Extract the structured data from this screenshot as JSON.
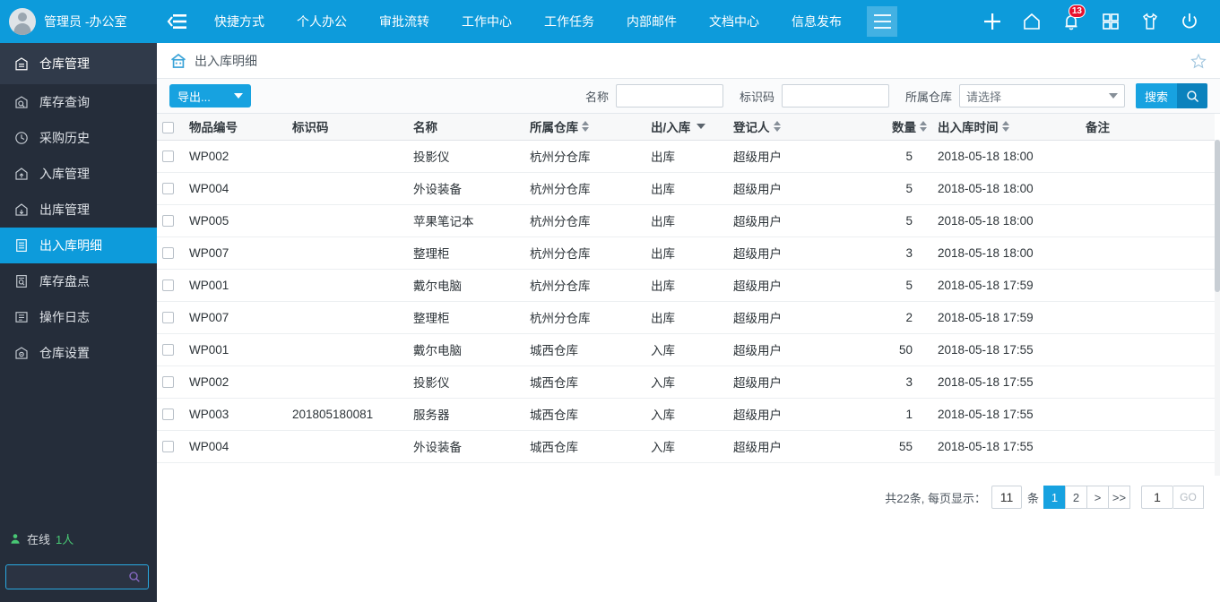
{
  "topbar": {
    "user_name": "管理员 -办公室",
    "avatar_icon": "user-avatar-icon",
    "menu_toggle_icon": "menu-collapse-icon",
    "nav_links": [
      "快捷方式",
      "个人办公",
      "审批流转",
      "工作中心",
      "工作任务",
      "内部邮件",
      "文档中心",
      "信息发布"
    ],
    "hamburger_icon": "hamburger-icon",
    "icons": [
      {
        "name": "plus-icon"
      },
      {
        "name": "home-icon"
      },
      {
        "name": "bell-icon",
        "badge": "13"
      },
      {
        "name": "grid-apps-icon"
      },
      {
        "name": "shirt-theme-icon"
      },
      {
        "name": "power-icon"
      }
    ],
    "accent_color": "#0d9bdb",
    "badge_color": "#e8112d"
  },
  "sidebar": {
    "header": {
      "label": "仓库管理",
      "icon": "warehouse-icon"
    },
    "items": [
      {
        "label": "库存查询",
        "icon": "inventory-search-icon",
        "active": false
      },
      {
        "label": "采购历史",
        "icon": "clock-history-icon",
        "active": false
      },
      {
        "label": "入库管理",
        "icon": "inbound-icon",
        "active": false
      },
      {
        "label": "出库管理",
        "icon": "outbound-icon",
        "active": false
      },
      {
        "label": "出入库明细",
        "icon": "detail-list-icon",
        "active": true
      },
      {
        "label": "库存盘点",
        "icon": "stocktake-icon",
        "active": false
      },
      {
        "label": "操作日志",
        "icon": "log-icon",
        "active": false
      },
      {
        "label": "仓库设置",
        "icon": "settings-warehouse-icon",
        "active": false
      }
    ],
    "online": {
      "icon": "person-online-icon",
      "label": "在线",
      "count": "1人",
      "count_color": "#48c774"
    },
    "search": {
      "value": "",
      "placeholder": "",
      "icon": "search-icon"
    }
  },
  "breadcrumb": {
    "icon": "home-breadcrumb-icon",
    "title": "出入库明细",
    "favorite_icon": "star-outline-icon"
  },
  "toolbar": {
    "export_label": "导出...",
    "export_caret_icon": "chevron-down-icon",
    "name_label": "名称",
    "name_value": "",
    "code_label": "标识码",
    "code_value": "",
    "warehouse_label": "所属仓库",
    "warehouse_selected": "请选择",
    "warehouse_caret_icon": "chevron-down-icon",
    "search_label": "搜索",
    "search_icon": "search-icon"
  },
  "table": {
    "select_all_checkbox": false,
    "columns": [
      {
        "key": "checkbox",
        "label": "",
        "sortable": false
      },
      {
        "key": "no",
        "label": "物品编号",
        "sortable": false
      },
      {
        "key": "code",
        "label": "标识码",
        "sortable": false
      },
      {
        "key": "name",
        "label": "名称",
        "sortable": false
      },
      {
        "key": "warehouse",
        "label": "所属仓库",
        "sortable": true
      },
      {
        "key": "io",
        "label": "出/入库",
        "sortable": false,
        "filter": true
      },
      {
        "key": "user",
        "label": "登记人",
        "sortable": true
      },
      {
        "key": "qty",
        "label": "数量",
        "sortable": true,
        "align": "right"
      },
      {
        "key": "time",
        "label": "出入库时间",
        "sortable": true
      },
      {
        "key": "note",
        "label": "备注",
        "sortable": false
      }
    ],
    "rows": [
      {
        "no": "WP002",
        "code": "",
        "name": "投影仪",
        "warehouse": "杭州分仓库",
        "io": "出库",
        "user": "超级用户",
        "qty": "5",
        "time": "2018-05-18 18:00",
        "note": ""
      },
      {
        "no": "WP004",
        "code": "",
        "name": "外设装备",
        "warehouse": "杭州分仓库",
        "io": "出库",
        "user": "超级用户",
        "qty": "5",
        "time": "2018-05-18 18:00",
        "note": ""
      },
      {
        "no": "WP005",
        "code": "",
        "name": "苹果笔记本",
        "warehouse": "杭州分仓库",
        "io": "出库",
        "user": "超级用户",
        "qty": "5",
        "time": "2018-05-18 18:00",
        "note": ""
      },
      {
        "no": "WP007",
        "code": "",
        "name": "整理柜",
        "warehouse": "杭州分仓库",
        "io": "出库",
        "user": "超级用户",
        "qty": "3",
        "time": "2018-05-18 18:00",
        "note": ""
      },
      {
        "no": "WP001",
        "code": "",
        "name": "戴尔电脑",
        "warehouse": "杭州分仓库",
        "io": "出库",
        "user": "超级用户",
        "qty": "5",
        "time": "2018-05-18 17:59",
        "note": ""
      },
      {
        "no": "WP007",
        "code": "",
        "name": "整理柜",
        "warehouse": "杭州分仓库",
        "io": "出库",
        "user": "超级用户",
        "qty": "2",
        "time": "2018-05-18 17:59",
        "note": ""
      },
      {
        "no": "WP001",
        "code": "",
        "name": "戴尔电脑",
        "warehouse": "城西仓库",
        "io": "入库",
        "user": "超级用户",
        "qty": "50",
        "time": "2018-05-18 17:55",
        "note": ""
      },
      {
        "no": "WP002",
        "code": "",
        "name": "投影仪",
        "warehouse": "城西仓库",
        "io": "入库",
        "user": "超级用户",
        "qty": "3",
        "time": "2018-05-18 17:55",
        "note": ""
      },
      {
        "no": "WP003",
        "code": "201805180081",
        "name": "服务器",
        "warehouse": "城西仓库",
        "io": "入库",
        "user": "超级用户",
        "qty": "1",
        "time": "2018-05-18 17:55",
        "note": ""
      },
      {
        "no": "WP004",
        "code": "",
        "name": "外设装备",
        "warehouse": "城西仓库",
        "io": "入库",
        "user": "超级用户",
        "qty": "55",
        "time": "2018-05-18 17:55",
        "note": ""
      }
    ]
  },
  "pagination": {
    "summary": "共22条, 每页显示：",
    "page_size": "11",
    "unit": "条",
    "pages": [
      "1",
      "2"
    ],
    "active_page": "1",
    "next_label": ">",
    "last_label": ">>",
    "jump_value": "1",
    "go_label": "GO"
  }
}
